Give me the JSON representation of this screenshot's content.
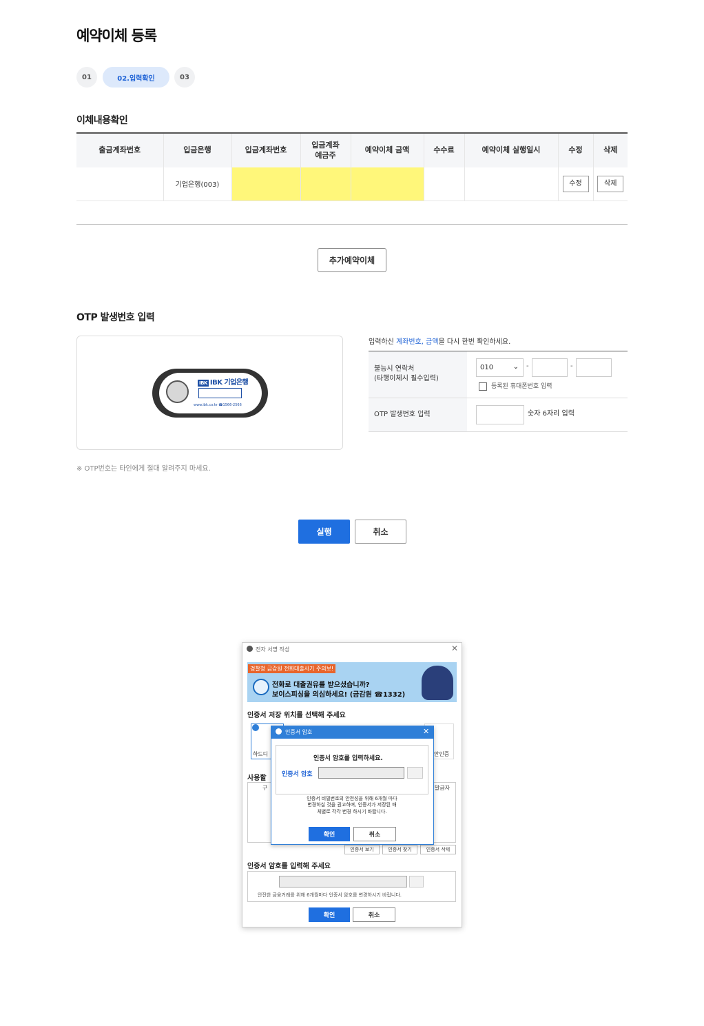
{
  "page": {
    "title": "예약이체 등록"
  },
  "steps": [
    {
      "label": "01",
      "active": false
    },
    {
      "label": "02.입력확인",
      "active": true
    },
    {
      "label": "03",
      "active": false
    }
  ],
  "transfer": {
    "section_title": "이체내용확인",
    "headers": [
      "출금계좌번호",
      "입금은행",
      "입금계좌번호",
      "입금계좌\n예금주",
      "예약이체 금액",
      "수수료",
      "예약이체 실행일시",
      "수정",
      "삭제"
    ],
    "rows": [
      {
        "withdraw_account": "",
        "bank": "기업은행(003)",
        "deposit_account": "",
        "holder": "",
        "amount": "",
        "fee": "",
        "datetime": "",
        "edit_label": "수정",
        "delete_label": "삭제"
      }
    ],
    "highlight_color": "#fff77a"
  },
  "add_button": "추가예약이체",
  "otp": {
    "section_title": "OTP 발생번호 입력",
    "device_brand": "IBK 기업은행",
    "device_url": "www.ibk.co.kr ☎1566-2566",
    "note": "※ OTP번호는 타인에게 절대 알려주지 마세요."
  },
  "confirm": {
    "msg_prefix": "입력하신 ",
    "msg_highlight": "계좌번호, 금액",
    "msg_suffix": "을 다시 한번 확인하세요.",
    "phone_label_1": "불능시 연락처",
    "phone_label_2": "(타행이체시 필수입력)",
    "phone_prefix": "010",
    "phone_checkbox_label": "등록된 휴대폰번호 입력",
    "otp_label": "OTP 발생번호 입력",
    "otp_hint": "숫자 6자리 입력"
  },
  "actions": {
    "run": "실행",
    "cancel": "취소"
  },
  "signature_dialog": {
    "title": "전자 서명 작성",
    "banner_tag": "경찰청 금감원 전화대출사기 주의보!",
    "banner_line1": "전화로 대출권유를 받으셨습니까?",
    "banner_line2": "보이스피싱을 의심하세요! (금감원 ☎1332)",
    "location_title": "인증서 저장 위치를 선택해 주세요",
    "loc_left": "하드디",
    "loc_right": "안인증",
    "use_title": "사용할",
    "col_left": "구",
    "col_right": "발급자",
    "cert_view": "인증서 보기",
    "cert_find": "인증서 찾기",
    "cert_delete": "인증서 삭제",
    "password_title": "인증서 암호를 입력해 주세요",
    "password_note": "안전한 금융거래를 위해 6개월마다 인증서 암호를 변경하시기 바랍니다.",
    "ok": "확인",
    "cancel": "취소"
  },
  "password_popup": {
    "title": "인증서 암호",
    "heading": "인증서 암호를 입력하세요.",
    "field_label": "인증서 암호",
    "note_line1": "인증서 비밀번호의 안전성을 위해 6개월 마다",
    "note_line2": "변경하실 것을 권고하며, 인증서가 저장된 매",
    "note_line3": "체별로 각각 변경 하시기 바랍니다.",
    "ok": "확인",
    "cancel": "취소"
  }
}
